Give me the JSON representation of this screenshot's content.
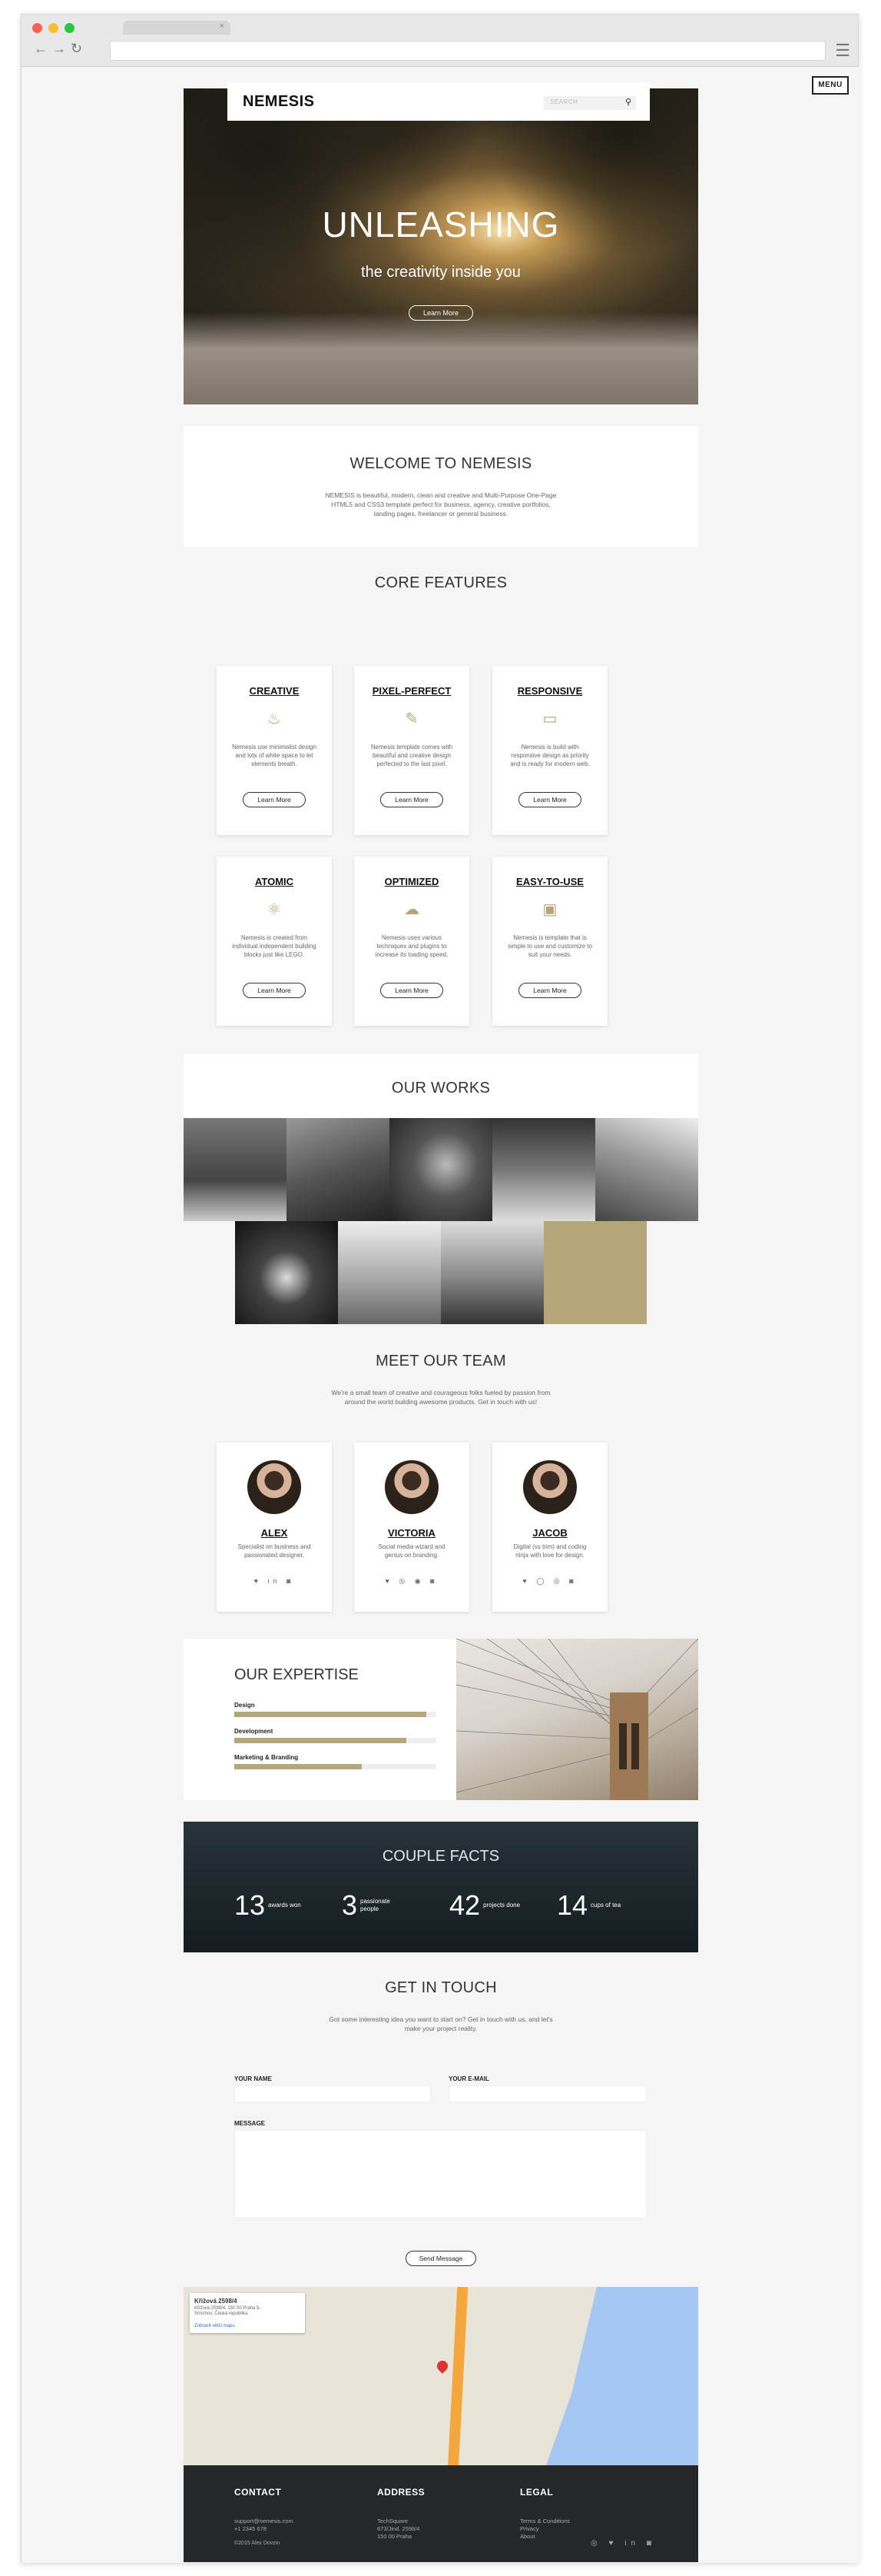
{
  "browser": {
    "menu_label": "MENU"
  },
  "header": {
    "logo": "NEMESIS",
    "search_placeholder": "SEARCH"
  },
  "hero": {
    "title": "UNLEASHING",
    "subtitle": "the creativity inside you",
    "button": "Learn More"
  },
  "welcome": {
    "title": "WELCOME TO NEMESIS",
    "text": "NEMESIS is beautiful, modern, clean and creative and Multi-Purpose One-Page HTML5 and CSS3 template perfect for business, agency, creative portfolios, landing pages, freelancer or general business."
  },
  "core": {
    "title": "CORE FEATURES",
    "features": [
      {
        "title": "CREATIVE",
        "icon": "lightbulb-icon",
        "glyph": "♨",
        "text": "Nemesis use minimalist design and lots of white space to let elements breath.",
        "button": "Learn More"
      },
      {
        "title": "PIXEL-PERFECT",
        "icon": "pen-icon",
        "glyph": "✎",
        "text": "Nemesis template comes with beautiful and creative design perfected to the last pixel.",
        "button": "Learn More"
      },
      {
        "title": "RESPONSIVE",
        "icon": "devices-icon",
        "glyph": "▭",
        "text": "Nemesis is build with responsive design as priority and is ready for modern web.",
        "button": "Learn More"
      },
      {
        "title": "ATOMIC",
        "icon": "atom-icon",
        "glyph": "⚛",
        "text": "Nemesis is created from individual independent building blocks just like LEGO.",
        "button": "Learn More"
      },
      {
        "title": "OPTIMIZED",
        "icon": "cloud-icon",
        "glyph": "☁",
        "text": "Nemesis uses various techniques and plugins to increase its loading speed.",
        "button": "Learn More"
      },
      {
        "title": "EASY-TO-USE",
        "icon": "image-icon",
        "glyph": "▣",
        "text": "Nemesis is template that is simple to use and customize to suit your needs.",
        "button": "Learn More"
      }
    ]
  },
  "works": {
    "title": "OUR WORKS"
  },
  "team": {
    "title": "MEET OUR TEAM",
    "subtitle": "We're a small team of creative and courageous folks fueled by passion from around the world building awesome products. Get in touch with us!",
    "members": [
      {
        "name": "ALEX",
        "desc": "Specialist on business and passionated designer.",
        "social": "♥ in ◙"
      },
      {
        "name": "VICTORIA",
        "desc": "Social media wizard and genius on branding.",
        "social": "♥ ◎ ◉ ◙"
      },
      {
        "name": "JACOB",
        "desc": "Digital (ss trim) and coding ninja with love for design.",
        "social": "♥ ◯ ◎ ◙"
      }
    ]
  },
  "expertise": {
    "title": "OUR EXPERTISE",
    "skills": [
      {
        "label": "Design",
        "percent": 95
      },
      {
        "label": "Development",
        "percent": 85
      },
      {
        "label": "Marketing & Branding",
        "percent": 63
      }
    ]
  },
  "facts": {
    "title": "COUPLE FACTS",
    "items": [
      {
        "num": "13",
        "label": "awards won"
      },
      {
        "num": "3",
        "label": "passionate people"
      },
      {
        "num": "42",
        "label": "projects done"
      },
      {
        "num": "14",
        "label": "cups of tea"
      }
    ]
  },
  "contact": {
    "title": "GET IN TOUCH",
    "subtitle": "Got some interesting idea you want to start on? Get in touch with us, and let's make your project reality.",
    "name_label": "YOUR NAME",
    "email_label": "YOUR E-MAIL",
    "message_label": "MESSAGE",
    "send": "Send Message"
  },
  "map": {
    "place": "Křižová 2598/4",
    "address": "Křižová 2598/4, 150 00 Praha 5-Smíchov, Česká republika",
    "link": "Zobrazit větší mapu"
  },
  "footer": {
    "contact": {
      "title": "CONTACT",
      "lines": "support@nemesis.com\n+1 2345 678"
    },
    "address": {
      "title": "ADDRESS",
      "lines": "TechSquare\n673/Jind. 2598/4\n150 00 Praha"
    },
    "legal": {
      "title": "LEGAL",
      "lines": "Terms & Conditions\nPrivacy\nAbout"
    },
    "copyright": "©2015 Alex Dovzin",
    "social": "◎ ♥ in ◙"
  },
  "colors": {
    "accent": "#b5a77a",
    "dark": "#25272b"
  }
}
